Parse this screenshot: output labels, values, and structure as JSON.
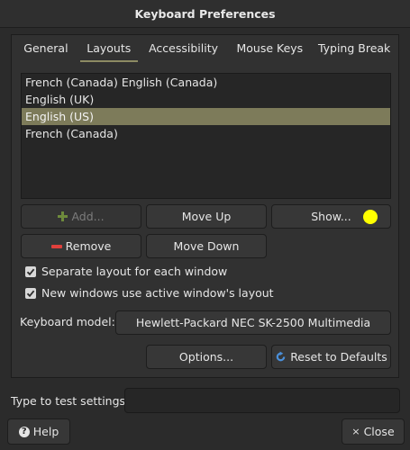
{
  "window": {
    "title": "Keyboard Preferences"
  },
  "tabs": [
    {
      "label": "General"
    },
    {
      "label": "Layouts"
    },
    {
      "label": "Accessibility"
    },
    {
      "label": "Mouse Keys"
    },
    {
      "label": "Typing Break"
    }
  ],
  "layouts": {
    "items": [
      {
        "label": "French (Canada) English (Canada)"
      },
      {
        "label": "English (UK)"
      },
      {
        "label": "English (US)",
        "selected": true
      },
      {
        "label": "French (Canada)"
      }
    ],
    "add_label": "Add...",
    "move_up_label": "Move Up",
    "show_label": "Show...",
    "remove_label": "Remove",
    "move_down_label": "Move Down"
  },
  "options": {
    "separate_layout_label": "Separate layout for each window",
    "separate_layout_checked": true,
    "new_windows_label": "New windows use active window's layout",
    "new_windows_checked": true
  },
  "keyboard_model": {
    "label": "Keyboard model:",
    "value": "Hewlett-Packard NEC SK-2500 Multimedia"
  },
  "actions": {
    "options_label": "Options...",
    "reset_label": "Reset to Defaults"
  },
  "test": {
    "label": "Type to test settings:",
    "value": ""
  },
  "footer": {
    "help_label": "Help",
    "close_label": "Close"
  },
  "colors": {
    "accent": "#7d7b5a",
    "add_icon": "#6e8a3c",
    "remove_icon": "#e0403c",
    "reset_icon": "#4a8fd9"
  }
}
